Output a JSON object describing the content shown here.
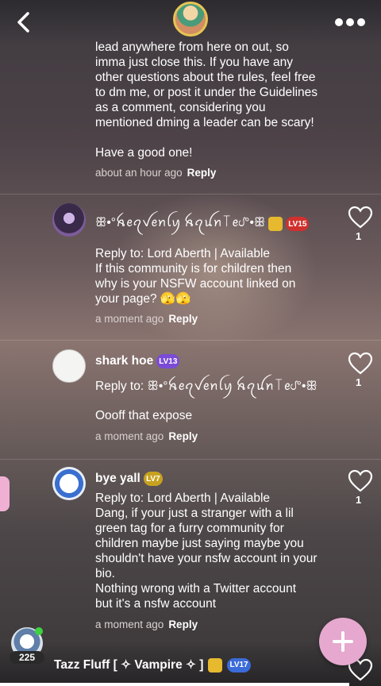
{
  "header": {
    "back_icon": "chevron-left-icon",
    "more_icon": "more-dots-icon"
  },
  "comments": [
    {
      "text_lines": "lead anywhere from here on out, so\nimma just close this. If you have any\nother questions about the rules, feel free\nto dm me, or post it under the Guidelines\nas a comment, considering you\nmentioned dming a leader can be scary!\n\nHave a good one!",
      "time": "about an hour ago",
      "reply": "Reply"
    },
    {
      "author": "ꕥ•°ꫝꫀꪖꪜꫀꪀꪶꪗ ꫝꪖꪊꪀ꓄ꫀᦔ°•ꕥ",
      "level": "LV15",
      "reply_to": "Reply to: Lord Aberth | Available",
      "text": "If this community is for children then\nwhy is your NSFW account linked on\nyour page? 🫣🫣",
      "time": "a moment ago",
      "reply": "Reply",
      "likes": "1"
    },
    {
      "author": "shark hoe",
      "level": "LV13",
      "reply_to": "Reply to: ꕥ•°ꫝꫀꪖꪜꫀꪀꪶꪗ ꫝꪖꪊꪀ꓄ꫀᦔ°•ꕥ",
      "text": "Oooff that expose",
      "time": "a moment ago",
      "reply": "Reply",
      "likes": "1"
    },
    {
      "author": "bye yall",
      "level": "LV7",
      "reply_to": "Reply to: Lord Aberth | Available",
      "text": "Dang, if your just a stranger with a lil\ngreen tag for a furry community for\nchildren maybe just saying maybe you\nshouldn't have your nsfw account in your\nbio.\nNothing wrong with a Twitter account\nbut it's a nsfw account",
      "time": "a moment ago",
      "reply": "Reply",
      "likes": "1"
    }
  ],
  "footer": {
    "count": "225",
    "user_name": "Tazz Fluff [ ✧ Vampire ✧ ]",
    "level": "LV17",
    "fab_icon": "plus-icon"
  }
}
